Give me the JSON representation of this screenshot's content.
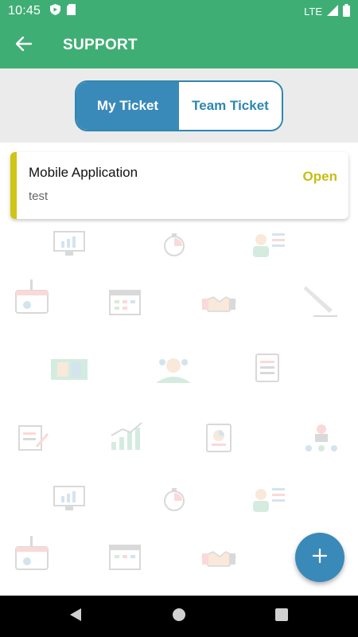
{
  "status_bar": {
    "time": "10:45",
    "network": "LTE",
    "icons": [
      "shield-icon",
      "sd-card-icon",
      "signal-icon",
      "battery-icon"
    ]
  },
  "app_bar": {
    "title": "SUPPORT",
    "back_icon": "arrow-back-icon",
    "color": "#3fae75"
  },
  "tabs": {
    "items": [
      {
        "label": "My Ticket",
        "active": true
      },
      {
        "label": "Team Ticket",
        "active": false
      }
    ],
    "accent": "#3a8ab9"
  },
  "tickets": [
    {
      "title": "Mobile Application",
      "description": "test",
      "status": "Open",
      "status_color": "#c8bd14"
    }
  ],
  "fab": {
    "icon": "plus-icon"
  },
  "nav_bar": {
    "icons": [
      "back-triangle-icon",
      "home-circle-icon",
      "recents-square-icon"
    ]
  }
}
